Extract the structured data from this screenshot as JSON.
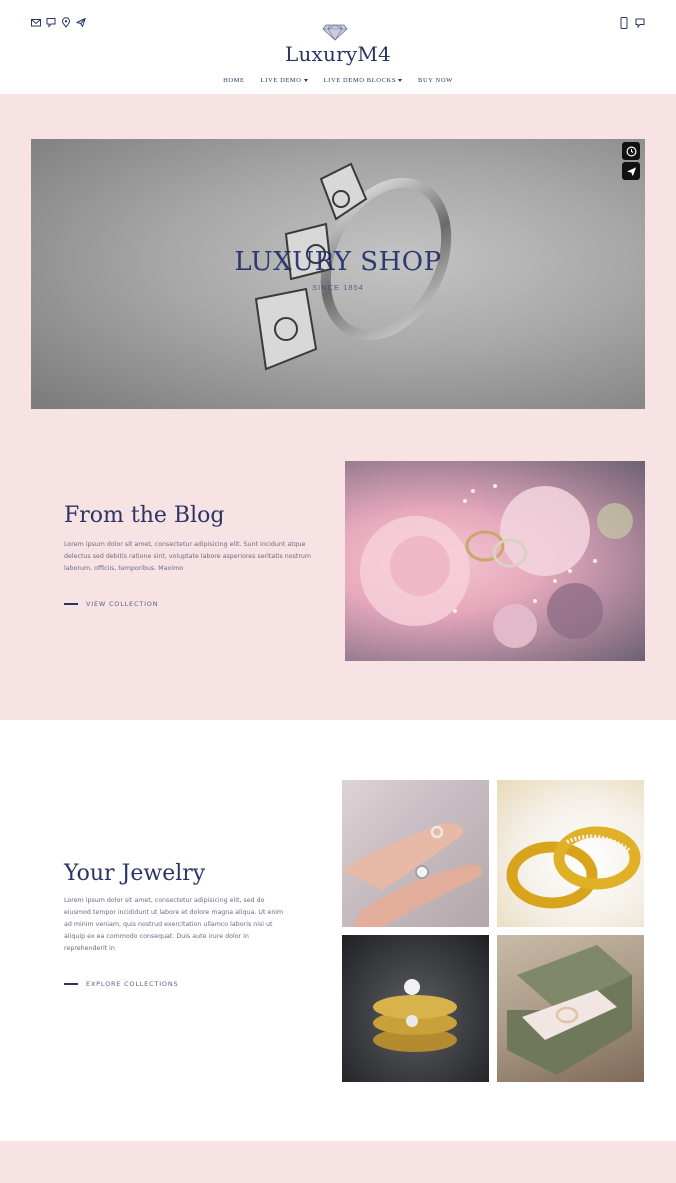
{
  "header": {
    "social_icons": [
      "mail-icon",
      "chat-icon",
      "location-pin-icon",
      "send-icon"
    ],
    "right_icons": [
      "phone-icon",
      "chat-icon"
    ],
    "logo_text": "LuxuryM4",
    "nav": [
      {
        "label": "HOME",
        "dropdown": false
      },
      {
        "label": "LIVE DEMO",
        "dropdown": true
      },
      {
        "label": "LIVE DEMO BLOCKS",
        "dropdown": true
      },
      {
        "label": "BUY NOW",
        "dropdown": false
      }
    ]
  },
  "hero": {
    "title": "LUXURY SHOP",
    "subtitle": "SINCE 1854",
    "buttons": [
      "clock-icon",
      "send-icon"
    ]
  },
  "blog": {
    "title": "From the Blog",
    "text": "Lorem ipsum dolor sit amet, consectetur adipisicing elit. Sunt incidunt atque delectus sed debitis ratione sint, voluptate labore asperiores seritatis nostrum laborum, officiis, temporibus. Maximo",
    "link": "VIEW COLLECTION"
  },
  "jewelry": {
    "title": "Your Jewelry",
    "text": "Lorem ipsum dolor sit amet, consectetur adipisicing elit, sed do eiusmod tempor incididunt ut labore et dolore magna aliqua. Ut enim ad minim veniam, quis nostrud exercitation ullamco laboris nisi ut aliquip ex ea commodo consequat. Duis aute irure dolor in reprehenderit in",
    "link": "EXPLORE COLLECTIONS"
  },
  "colors": {
    "accent": "#2a3566",
    "pink_bg": "#f7e3e3",
    "text_muted": "#6b6b86"
  }
}
